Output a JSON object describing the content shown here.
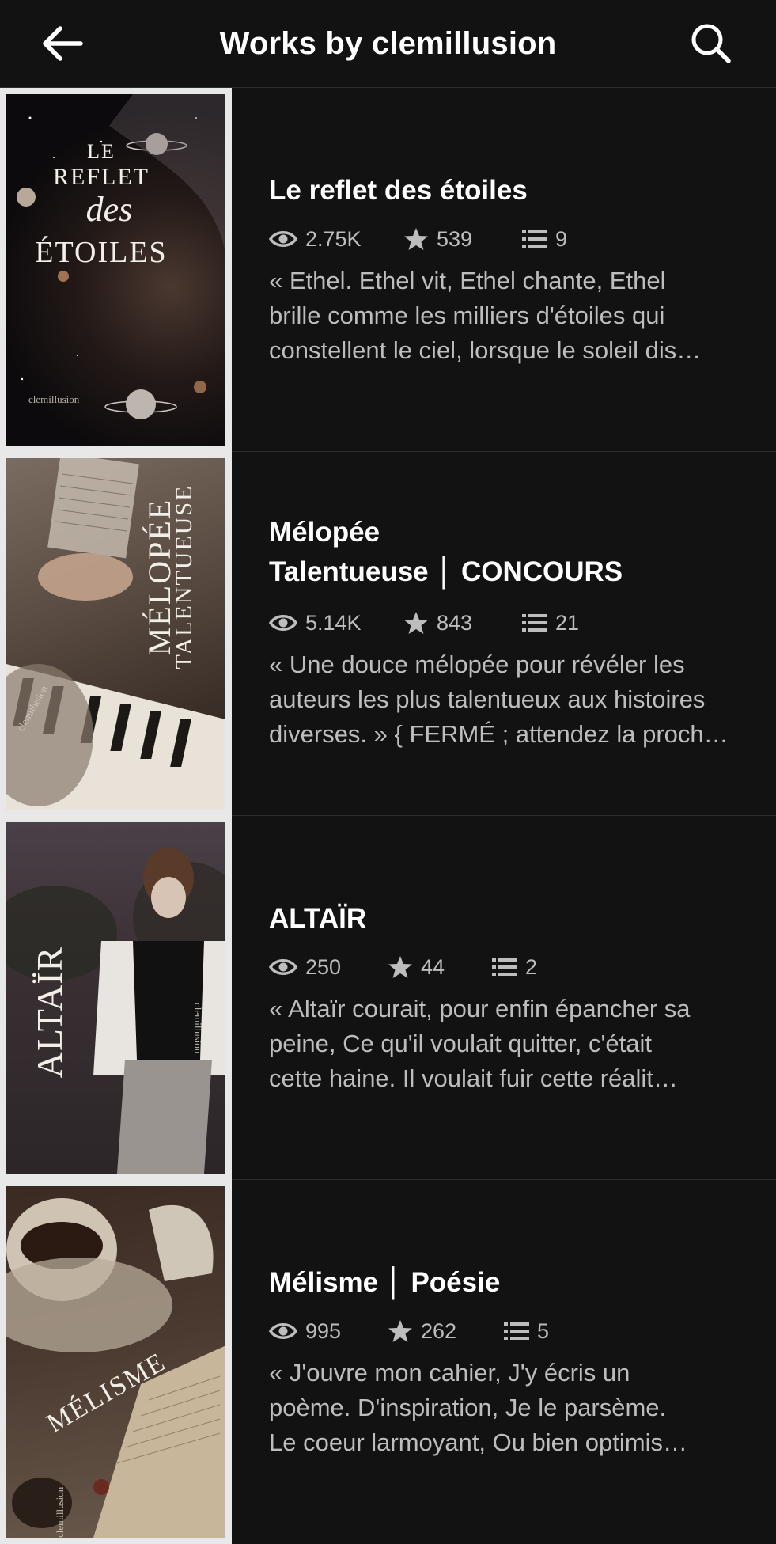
{
  "header": {
    "title": "Works by clemillusion",
    "back_icon": "arrow-left-icon",
    "search_icon": "search-icon"
  },
  "stories": [
    {
      "title_lines": [
        "Le reflet des étoiles"
      ],
      "reads": "2.75K",
      "votes": "539",
      "parts": "9",
      "desc_lines": [
        "« Ethel. Ethel vit, Ethel chante, Ethel",
        "brille comme les milliers d'étoiles qui",
        "constellent le ciel, lorsque le soleil dis…"
      ],
      "cover": {
        "line1": "LE",
        "line2": "REFLET",
        "line3": "des",
        "line4": "ÉTOILES",
        "signature": "clemillusion"
      }
    },
    {
      "title_lines": [
        "Mélopée",
        "Talentueuse │ CONCOURS"
      ],
      "reads": "5.14K",
      "votes": "843",
      "parts": "21",
      "desc_lines": [
        "« Une douce mélopée pour révéler les",
        "auteurs les plus talentueux aux histoires",
        "diverses. » { FERMÉ ; attendez la proch…"
      ],
      "cover": {
        "line1": "MÉLOPÉE",
        "line2": "TALENTUEUSE",
        "signature": "clemillusion"
      }
    },
    {
      "title_lines": [
        "ALTAÏR"
      ],
      "reads": "250",
      "votes": "44",
      "parts": "2",
      "desc_lines": [
        "« Altaïr courait, pour enfin épancher sa",
        "peine,    Ce qu'il voulait quitter, c'était",
        "cette haine.     Il voulait fuir cette réalit…"
      ],
      "cover": {
        "line1": "ALTAÏR",
        "signature": "clemillusion"
      }
    },
    {
      "title_lines": [
        "Mélisme │ Poésie"
      ],
      "reads": "995",
      "votes": "262",
      "parts": "5",
      "desc_lines": [
        "« J'ouvre mon cahier,    J'y écris un",
        "poème.    D'inspiration,    Je le parsème.",
        "Le coeur larmoyant,    Ou bien optimis…"
      ],
      "cover": {
        "line1": "MÉLISME",
        "signature": "clemillusion"
      }
    }
  ]
}
